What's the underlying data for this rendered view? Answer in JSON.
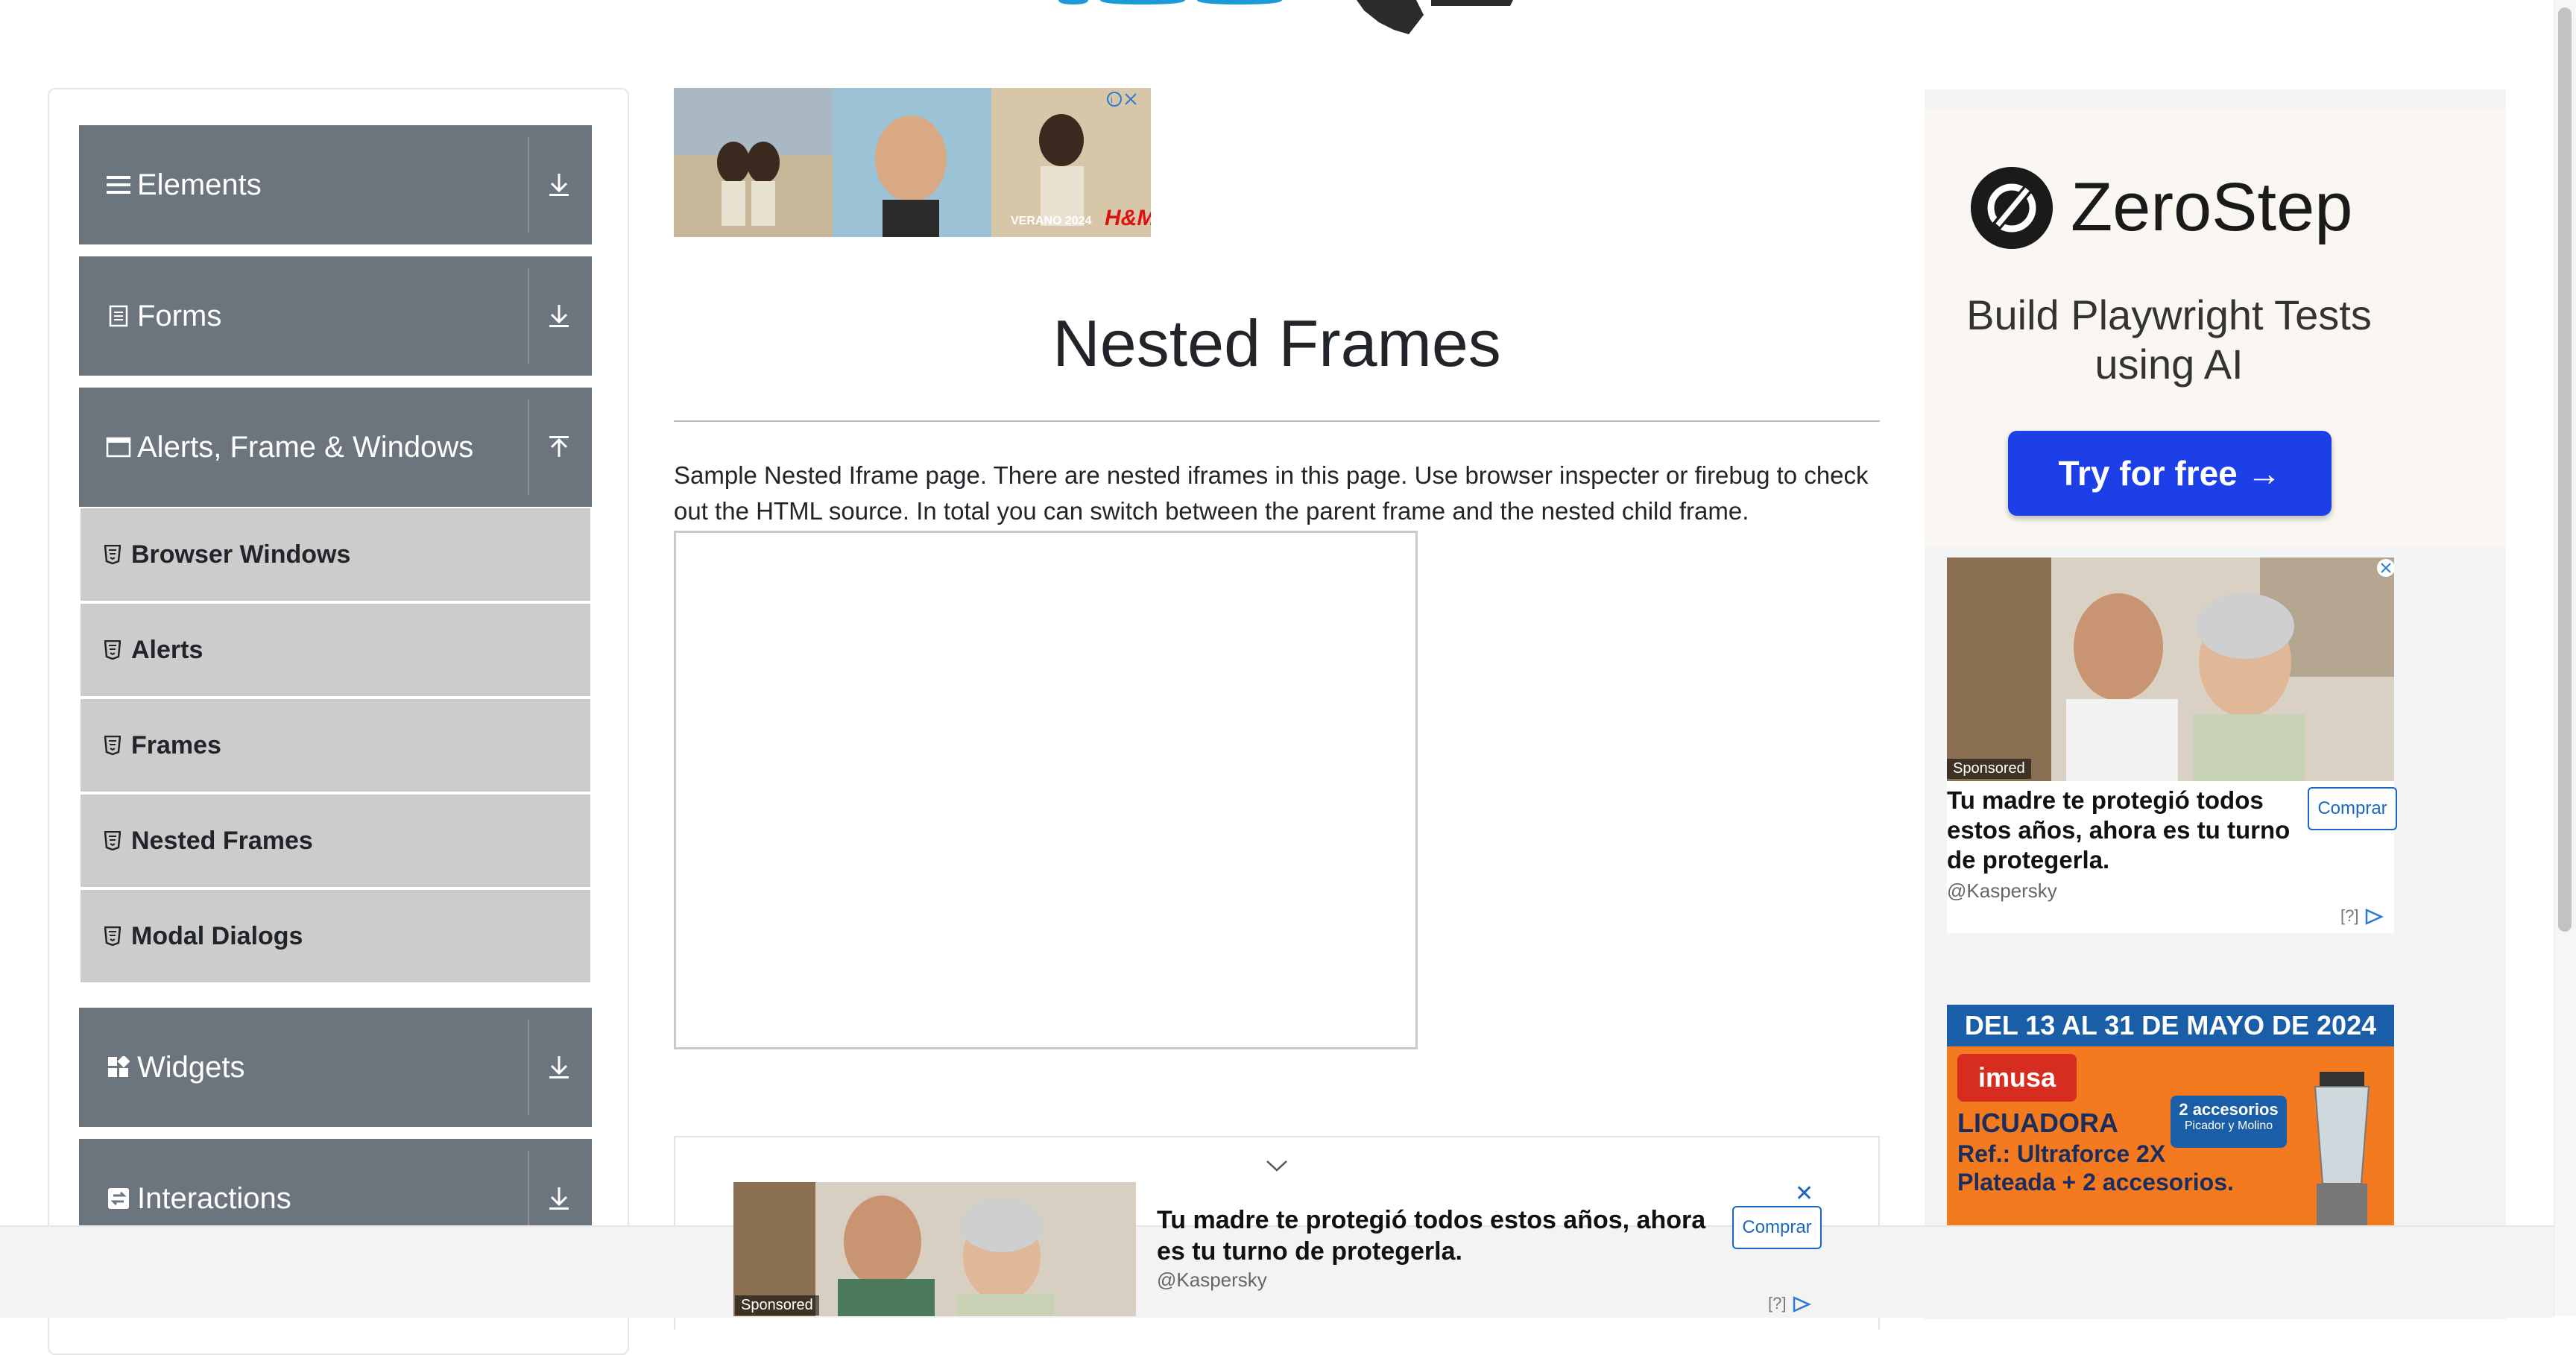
{
  "sidebar": {
    "groups": [
      {
        "label": "Elements",
        "icon": "list-icon",
        "state": "collapsed"
      },
      {
        "label": "Forms",
        "icon": "document-icon",
        "state": "collapsed"
      },
      {
        "label": "Alerts, Frame & Windows",
        "icon": "window-icon",
        "state": "expanded"
      },
      {
        "label": "Widgets",
        "icon": "widgets-icon",
        "state": "collapsed"
      },
      {
        "label": "Interactions",
        "icon": "interactions-icon",
        "state": "collapsed"
      }
    ],
    "alerts_items": [
      {
        "label": "Browser Windows"
      },
      {
        "label": "Alerts"
      },
      {
        "label": "Frames"
      },
      {
        "label": "Nested Frames"
      },
      {
        "label": "Modal Dialogs"
      }
    ]
  },
  "main": {
    "title": "Nested Frames",
    "description": "Sample Nested Iframe page. There are nested iframes in this page. Use browser inspecter or firebug to check out the HTML source. In total you can switch between the parent frame and the nested child frame.",
    "top_ad": {
      "caption": "VERANO 2024",
      "brand": "H&M"
    }
  },
  "right_ads": {
    "zerostep": {
      "name": "ZeroStep",
      "tagline": "Build Playwright Tests using AI",
      "cta": "Try for free →"
    },
    "kaspersky": {
      "sponsored": "Sponsored",
      "headline": "Tu madre te protegió todos estos años, ahora es tu turno de protegerla.",
      "source": "@Kaspersky",
      "button": "Comprar",
      "adchoice": "[?]"
    },
    "imusa": {
      "dates": "DEL 13 AL 31 DE MAYO DE 2024",
      "brand": "imusa",
      "product": "LICUADORA",
      "ref": "Ref.: Ultraforce 2X",
      "variant": "Plateada + 2 accesorios.",
      "badge_line1": "2 accesorios",
      "badge_line2": "Picador y Molino"
    }
  },
  "sticky_ad": {
    "sponsored": "Sponsored",
    "headline": "Tu madre te protegió todos estos años, ahora es tu turno de protegerla.",
    "source": "@Kaspersky",
    "button": "Comprar",
    "adchoice": "[?]",
    "close": "✕"
  },
  "colors": {
    "group_header": "#6c757d",
    "menu_item": "#cccccc",
    "zerostep_button": "#1d3fe8",
    "ad_link": "#1a66c2",
    "imusa_orange": "#f47a20"
  }
}
